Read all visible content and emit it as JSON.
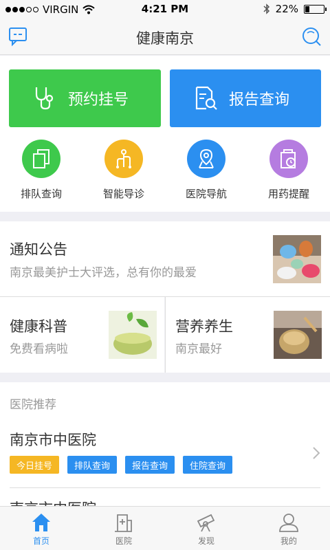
{
  "status_bar": {
    "carrier": "VIRGIN",
    "time": "4:21 PM",
    "battery": "22%",
    "battery_level": 0.22
  },
  "nav": {
    "title": "健康南京",
    "left_icon": "message-icon",
    "right_icon": "search-icon"
  },
  "main_actions": [
    {
      "label": "预约挂号",
      "icon": "stethoscope-icon",
      "color": "#3ec94c"
    },
    {
      "label": "报告查询",
      "icon": "report-search-icon",
      "color": "#2b8ff0"
    }
  ],
  "quick_actions": [
    {
      "label": "排队查询",
      "icon": "queue-icon",
      "color": "#3ec94c"
    },
    {
      "label": "智能导诊",
      "icon": "guide-icon",
      "color": "#f5b724"
    },
    {
      "label": "医院导航",
      "icon": "map-pin-icon",
      "color": "#2b8ff0"
    },
    {
      "label": "用药提醒",
      "icon": "medicine-clock-icon",
      "color": "#b57ce0"
    }
  ],
  "notice": {
    "title": "通知公告",
    "subtitle": "南京最美护士大评选，总有你的最爱"
  },
  "cards": [
    {
      "title": "健康科普",
      "subtitle": "免费看病啦"
    },
    {
      "title": "营养养生",
      "subtitle": "南京最好"
    }
  ],
  "recommend": {
    "section_title": "医院推荐",
    "hospitals": [
      {
        "name": "南京市中医院",
        "tags": [
          "今日挂号",
          "排队查询",
          "报告查询",
          "住院查询"
        ]
      },
      {
        "name": "南京市中医院"
      }
    ]
  },
  "tabs": [
    {
      "label": "首页",
      "icon": "home-icon",
      "active": true
    },
    {
      "label": "医院",
      "icon": "hospital-icon",
      "active": false
    },
    {
      "label": "发现",
      "icon": "telescope-icon",
      "active": false
    },
    {
      "label": "我的",
      "icon": "user-icon",
      "active": false
    }
  ],
  "colors": {
    "accent": "#2b8ff0",
    "green": "#3ec94c",
    "orange": "#f5b724",
    "purple": "#b57ce0"
  }
}
